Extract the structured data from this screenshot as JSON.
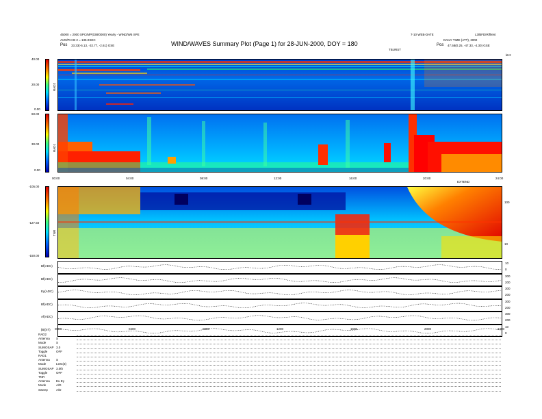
{
  "header": {
    "left_line1": "45000 = 2000 SPC/MP(038/0000) Yearly - WIND/W5 SPE",
    "left_line2": "AVG/PHI B 2 = 135.0SEC",
    "pos_left_label": "Pos",
    "pos_left_value": "33.33(-5.13, -32.77, -2.61) GSE",
    "right_line1": "7-10 WEB-DATE",
    "right_line2": "DAILY TIME (ATT), 2002",
    "right_corner": "L3/BFDIR/filent",
    "pos_right_label": "Pos",
    "pos_right_value": "47.58(0.25, -47.33, -4.30) GSE",
    "title": "WIND/WAVES Summary Plot (Page 1) for 28-JUN-2000, DOY = 180",
    "ticks_tag": "TBURST",
    "khz_tag": "kHz"
  },
  "colors": {
    "bg_deep": "#0030c0",
    "bg_mid": "#00a0ff",
    "hot": "#e00000",
    "warm": "#ffff00",
    "cool": "#00e0ff"
  },
  "rad2": {
    "label": "RAD2",
    "ticks": [
      "40.00",
      "20.00",
      "0.00"
    ]
  },
  "rad1": {
    "label": "RAD1",
    "ticks": [
      "60.00",
      "30.00",
      "0.00"
    ],
    "time_ticks": [
      "00:00",
      "04:00",
      "08:00",
      "12:00",
      "16:00",
      "20:00",
      "24:00"
    ],
    "time_tag": "EXTEND"
  },
  "tnr": {
    "label": "TNR",
    "ticks": [
      "-105.00",
      "-127.50",
      "-150.00"
    ],
    "right_ticks": [
      "100",
      "10"
    ]
  },
  "traces": [
    {
      "label": "Bf(ADC)",
      "r1": "10",
      "r2": "0"
    },
    {
      "label": "Bf(ADC)",
      "r1": "300",
      "r2": "200"
    },
    {
      "label": "Ey(ADC)",
      "r1": "300",
      "r2": "200"
    },
    {
      "label": "Bf(ADC)",
      "r1": "300",
      "r2": "200"
    },
    {
      "label": "Af(ADC)",
      "r1": "300",
      "r2": "200"
    },
    {
      "label": "|B|(nT)",
      "r1": "10",
      "r2": "0"
    }
  ],
  "bottom_time_ticks": [
    "0000",
    "0400",
    "0800",
    "1200",
    "1600",
    "2000",
    "2400"
  ],
  "footer": {
    "rows": [
      {
        "k": "RAD2",
        "v": ""
      },
      {
        "k": "Antenna",
        "v": "S"
      },
      {
        "k": "Mode",
        "v": "S"
      },
      {
        "k": "SUMOSAP",
        "v": "3.0"
      },
      {
        "k": "Toggle",
        "v": "OFF"
      },
      {
        "k": "RAD1",
        "v": ""
      },
      {
        "k": "Antenna",
        "v": "S"
      },
      {
        "k": "Mode",
        "v": "LOG(3)"
      },
      {
        "k": "SUMOSAP",
        "v": "3.0th"
      },
      {
        "k": "Toggle",
        "v": "OFF"
      },
      {
        "k": "TNR",
        "v": ""
      },
      {
        "k": "Antenna",
        "v": "Eu Ey"
      },
      {
        "k": "Mode",
        "v": "A/D"
      },
      {
        "k": "Sweep",
        "v": "A/D"
      }
    ]
  },
  "chart_data": [
    {
      "type": "heatmap",
      "title": "WIND/WAVES Summary Plot (Page 1) for 28-JUN-2000, DOY = 180",
      "ylabel": "RAD2",
      "ylim": [
        0,
        40
      ],
      "x_range": [
        0,
        24
      ],
      "note": "dynamic spectrum"
    },
    {
      "type": "heatmap",
      "ylabel": "RAD1",
      "ylim": [
        0,
        60
      ],
      "x_range": [
        0,
        24
      ],
      "xticks": [
        "00:00",
        "04:00",
        "08:00",
        "12:00",
        "16:00",
        "20:00",
        "24:00"
      ]
    },
    {
      "type": "heatmap",
      "ylabel": "TNR",
      "ylim": [
        -150,
        -105
      ],
      "x_range": [
        0,
        24
      ]
    },
    {
      "type": "line",
      "series": [
        {
          "name": "Bf(ADC)"
        },
        {
          "name": "Bf(ADC)"
        },
        {
          "name": "Ey(ADC)"
        },
        {
          "name": "Bf(ADC)"
        },
        {
          "name": "Af(ADC)"
        },
        {
          "name": "|B|(nT)"
        }
      ],
      "xticks": [
        "0000",
        "0400",
        "0800",
        "1200",
        "1600",
        "2000",
        "2400"
      ]
    }
  ]
}
